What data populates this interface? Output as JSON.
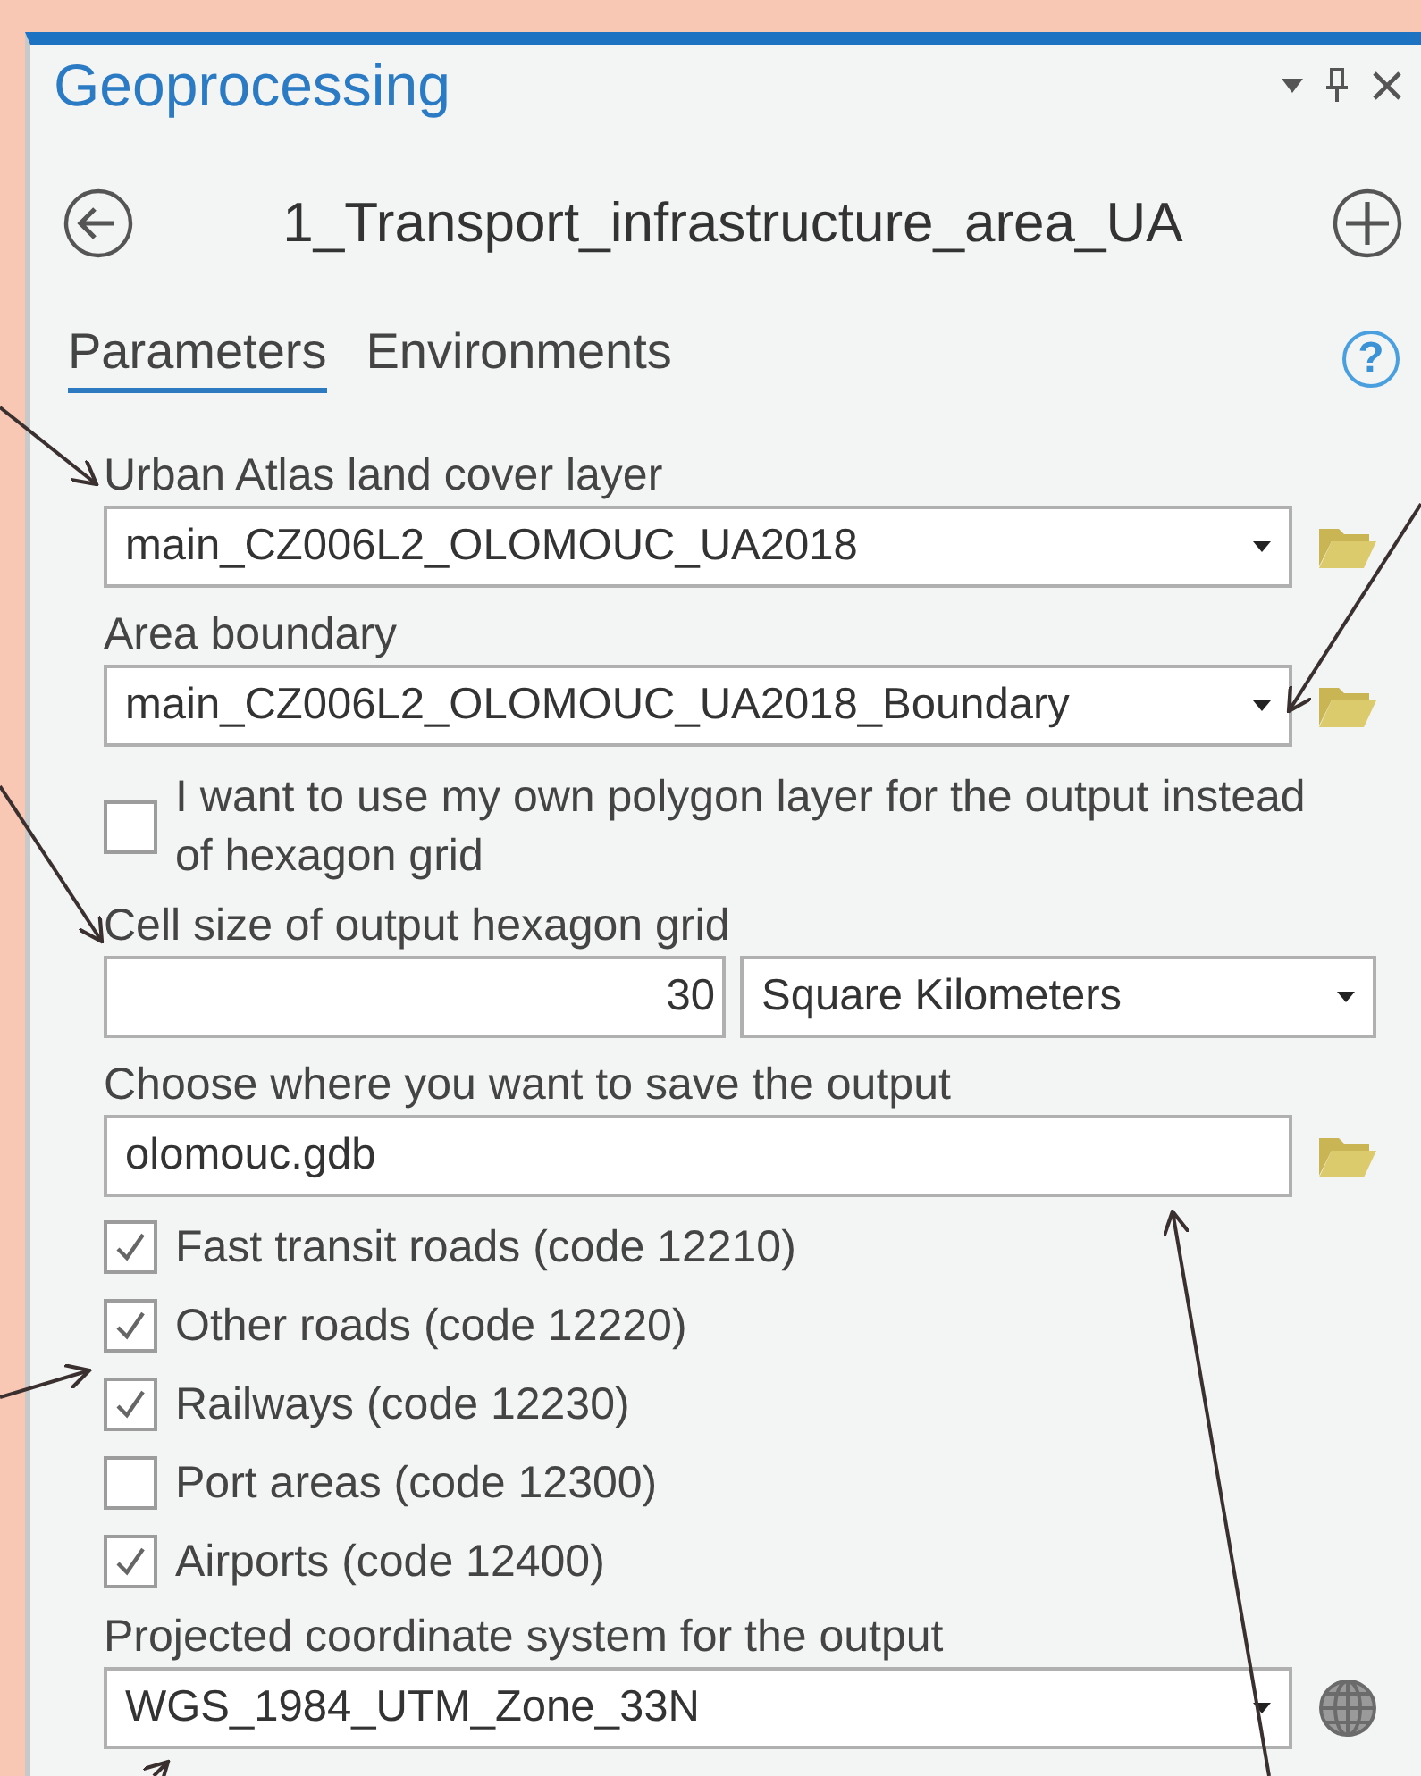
{
  "window": {
    "title": "Geoprocessing"
  },
  "tool": {
    "title": "1_Transport_infrastructure_area_UA"
  },
  "tabs": [
    {
      "label": "Parameters",
      "selected": true
    },
    {
      "label": "Environments",
      "selected": false
    }
  ],
  "help_button": "?",
  "parameters": [
    {
      "kind": "layer",
      "label": "Urban Atlas land cover layer",
      "value": "main_CZ006L2_OLOMOUC_UA2018"
    },
    {
      "kind": "layer",
      "label": "Area boundary",
      "value": "main_CZ006L2_OLOMOUC_UA2018_Boundary"
    },
    {
      "kind": "checkbox",
      "label": "I want to use my own polygon layer for the output instead of hexagon grid",
      "checked": false
    },
    {
      "kind": "size",
      "label": "Cell size of output hexagon grid",
      "value": "30",
      "unit": "Square Kilometers"
    },
    {
      "kind": "workspace",
      "label": "Choose where you want to save the output",
      "value": "olomouc.gdb"
    },
    {
      "kind": "checkbox",
      "label": "Fast transit roads (code 12210)",
      "checked": true
    },
    {
      "kind": "checkbox",
      "label": "Other roads (code 12220)",
      "checked": true
    },
    {
      "kind": "checkbox",
      "label": "Railways (code 12230)",
      "checked": true
    },
    {
      "kind": "checkbox",
      "label": "Port areas (code 12300)",
      "checked": false
    },
    {
      "kind": "checkbox",
      "label": "Airports (code 12400)",
      "checked": true
    },
    {
      "kind": "coordsys",
      "label": "Projected coordinate system for the output",
      "value": "WGS_1984_UTM_Zone_33N"
    }
  ]
}
